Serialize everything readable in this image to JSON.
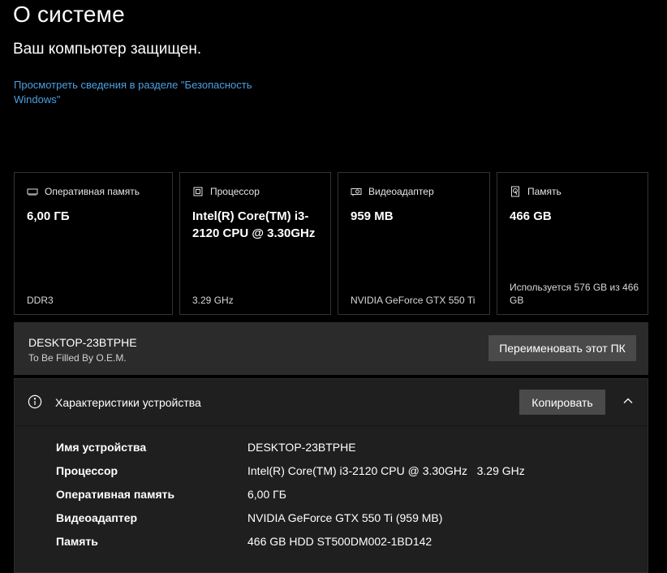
{
  "page": {
    "title": "О системе",
    "status": "Ваш компьютер защищен.",
    "security_link": "Просмотреть сведения в разделе \"Безопасность Windows\""
  },
  "cards": [
    {
      "icon": "memory-icon",
      "title": "Оперативная память",
      "value": "6,00 ГБ",
      "sub": "DDR3"
    },
    {
      "icon": "processor-icon",
      "title": "Процессор",
      "value": "Intel(R) Core(TM) i3-2120 CPU @ 3.30GHz",
      "sub": "3.29 GHz"
    },
    {
      "icon": "gpu-icon",
      "title": "Видеоадаптер",
      "value": "959 MB",
      "sub": "NVIDIA GeForce GTX 550 Ti"
    },
    {
      "icon": "storage-icon",
      "title": "Память",
      "value": "466 GB",
      "sub": "Используется 576 GB из 466 GB"
    }
  ],
  "pc": {
    "name": "DESKTOP-23BTPHE",
    "model": "To Be Filled By O.E.M.",
    "rename_label": "Переименовать этот ПК"
  },
  "specs": {
    "title": "Характеристики устройства",
    "copy_label": "Копировать",
    "rows": [
      {
        "label": "Имя устройства",
        "value": "DESKTOP-23BTPHE"
      },
      {
        "label": "Процессор",
        "value": "Intel(R) Core(TM) i3-2120 CPU @ 3.30GHz   3.29 GHz"
      },
      {
        "label": "Оперативная память",
        "value": "6,00 ГБ"
      },
      {
        "label": "Видеоадаптер",
        "value": "NVIDIA GeForce GTX 550 Ti (959 MB)"
      },
      {
        "label": "Память",
        "value": "466 GB HDD ST500DM002-1BD142"
      }
    ]
  },
  "colors": {
    "background": "#000000",
    "link": "#4ca0e0",
    "card_border": "#333333",
    "bar": "#2b2b2b",
    "panel": "#1f1f1f",
    "button": "#4a4a4a"
  }
}
